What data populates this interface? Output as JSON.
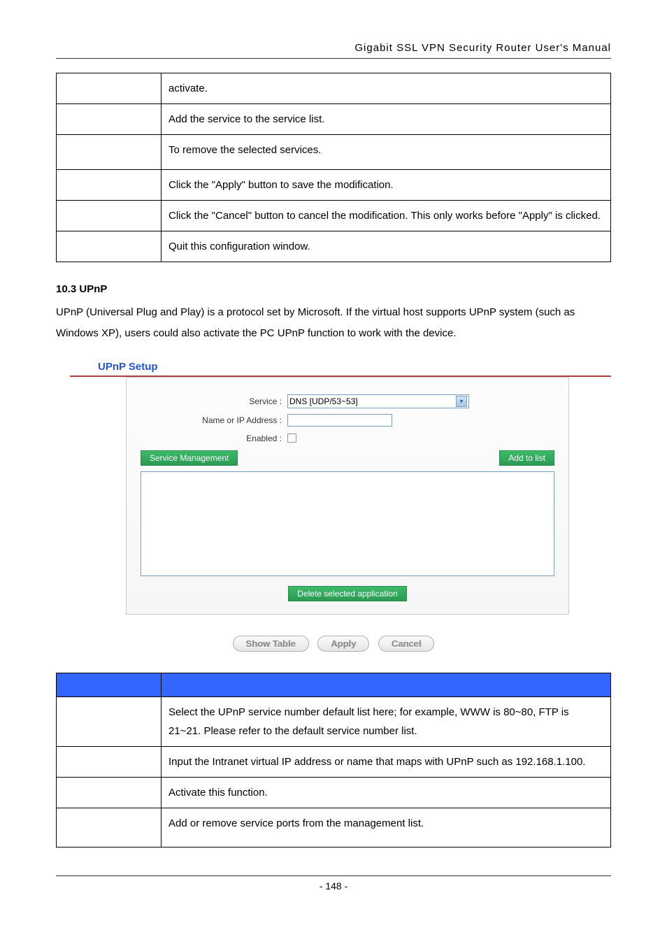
{
  "header": "Gigabit SSL VPN Security Router User's Manual",
  "table1": {
    "rows": [
      {
        "label": "",
        "desc": "activate."
      },
      {
        "label": "",
        "desc": "Add the service to the service list."
      },
      {
        "label": "",
        "desc": "To remove the selected services."
      },
      {
        "label": "",
        "desc": "Click the \"Apply\" button to save the modification."
      },
      {
        "label": "",
        "desc": "Click the \"Cancel\" button to cancel the modification. This only works before \"Apply\" is clicked."
      },
      {
        "label": "",
        "desc": "Quit this configuration window."
      }
    ]
  },
  "section_number": "10.3 UPnP",
  "para1": "UPnP (Universal Plug and Play) is a protocol set by Microsoft. If the virtual host supports UPnP system (such as Windows XP), users could also activate the PC UPnP function to work with the device.",
  "upnp_setup": {
    "heading": "UPnP Setup",
    "service_label": "Service :",
    "service_value": "DNS [UDP/53~53]",
    "name_label": "Name or IP Address :",
    "name_value": "",
    "enabled_label": "Enabled :",
    "btn_service_mgmt": "Service Management",
    "btn_add": "Add to list",
    "btn_delete": "Delete selected application"
  },
  "bottom_buttons": {
    "show_table": "Show Table",
    "apply": "Apply",
    "cancel": "Cancel"
  },
  "table2": {
    "header_left": "",
    "header_right": "",
    "rows": [
      {
        "label": "",
        "desc": "Select the UPnP service number default list here; for example, WWW is 80~80, FTP is 21~21. Please refer to the default service number list."
      },
      {
        "label": "",
        "desc": "Input the Intranet virtual IP address or name that maps with UPnP such as 192.168.1.100."
      },
      {
        "label": "",
        "desc": "Activate this function."
      },
      {
        "label": "",
        "desc": "Add or remove service ports from the management list."
      }
    ]
  },
  "page_number": "- 148 -"
}
